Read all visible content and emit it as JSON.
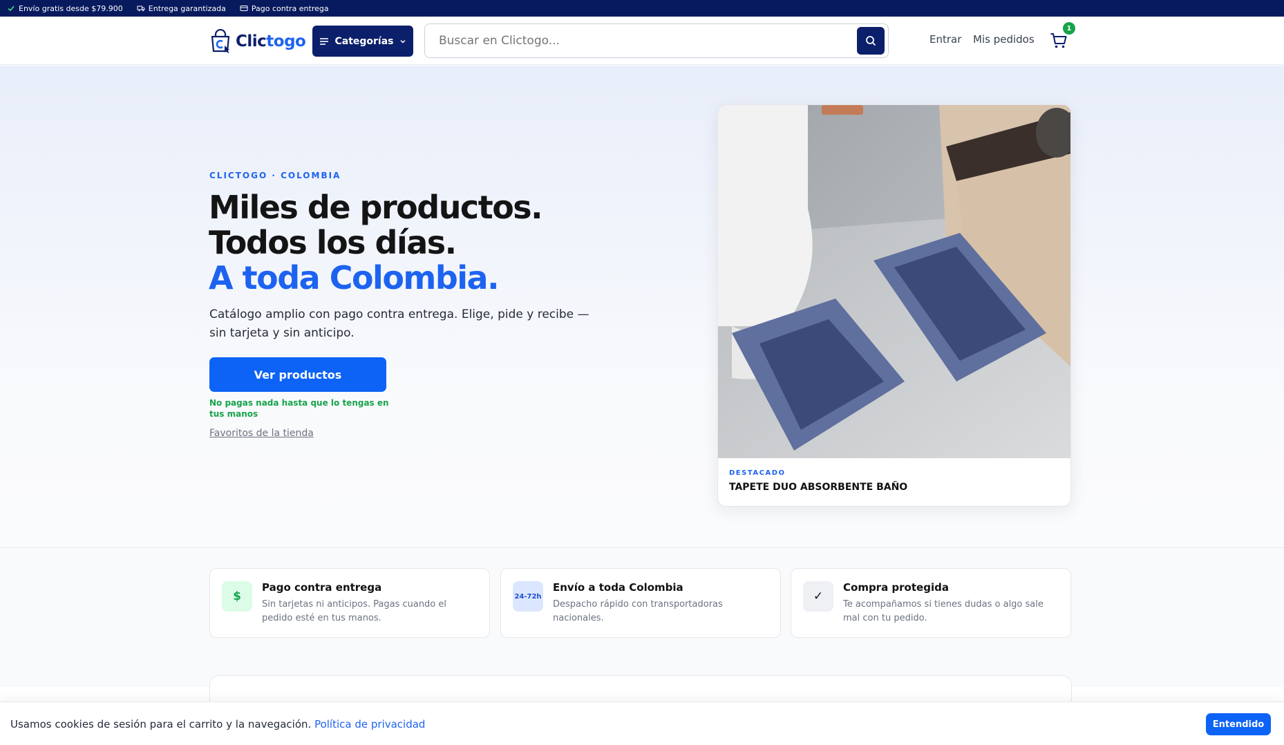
{
  "topbar": {
    "items": [
      {
        "icon": "check-icon",
        "label": "Envío gratis desde $79.900"
      },
      {
        "icon": "truck-icon",
        "label": "Entrega garantizada"
      },
      {
        "icon": "card-icon",
        "label": "Pago contra entrega"
      }
    ]
  },
  "header": {
    "logo_part1": "Clic",
    "logo_part2": "togo",
    "categories_label": "Categorías",
    "search_placeholder": "Buscar en Clictogo...",
    "login_label": "Entrar",
    "orders_label": "Mis pedidos",
    "cart_count": "1"
  },
  "hero": {
    "eyebrow": "CLICTOGO · COLOMBIA",
    "headline_line1": "Miles de productos.",
    "headline_line2": "Todos los días.",
    "headline_line3": "A toda Colombia.",
    "lead": "Catálogo amplio con pago contra entrega. Elige, pide y recibe — sin tarjeta y sin anticipo.",
    "cta_label": "Ver productos",
    "cta_note": "No pagas nada hasta que lo tengas en tus manos",
    "favorites_link": "Favoritos de la tienda",
    "featured": {
      "tag": "DESTACADO",
      "title": "TAPETE DUO ABSORBENTE BAÑO"
    }
  },
  "benefits": [
    {
      "icon_text": "$",
      "title": "Pago contra entrega",
      "desc": "Sin tarjetas ni anticipos. Pagas cuando el pedido esté en tus manos."
    },
    {
      "icon_text": "24-72h",
      "title": "Envío a toda Colombia",
      "desc": "Despacho rápido con transportadoras nacionales."
    },
    {
      "icon_text": "✓",
      "title": "Compra protegida",
      "desc": "Te acompañamos si tienes dudas o algo sale mal con tu pedido."
    }
  ],
  "cookie": {
    "text": "Usamos cookies de sesión para el carrito y la navegación.",
    "link": "Política de privacidad",
    "button": "Entendido"
  },
  "colors": {
    "navy": "#0b1f6b",
    "brand_blue": "#1d63f0",
    "cta_blue": "#0d63f5",
    "success_green": "#16a34a"
  }
}
